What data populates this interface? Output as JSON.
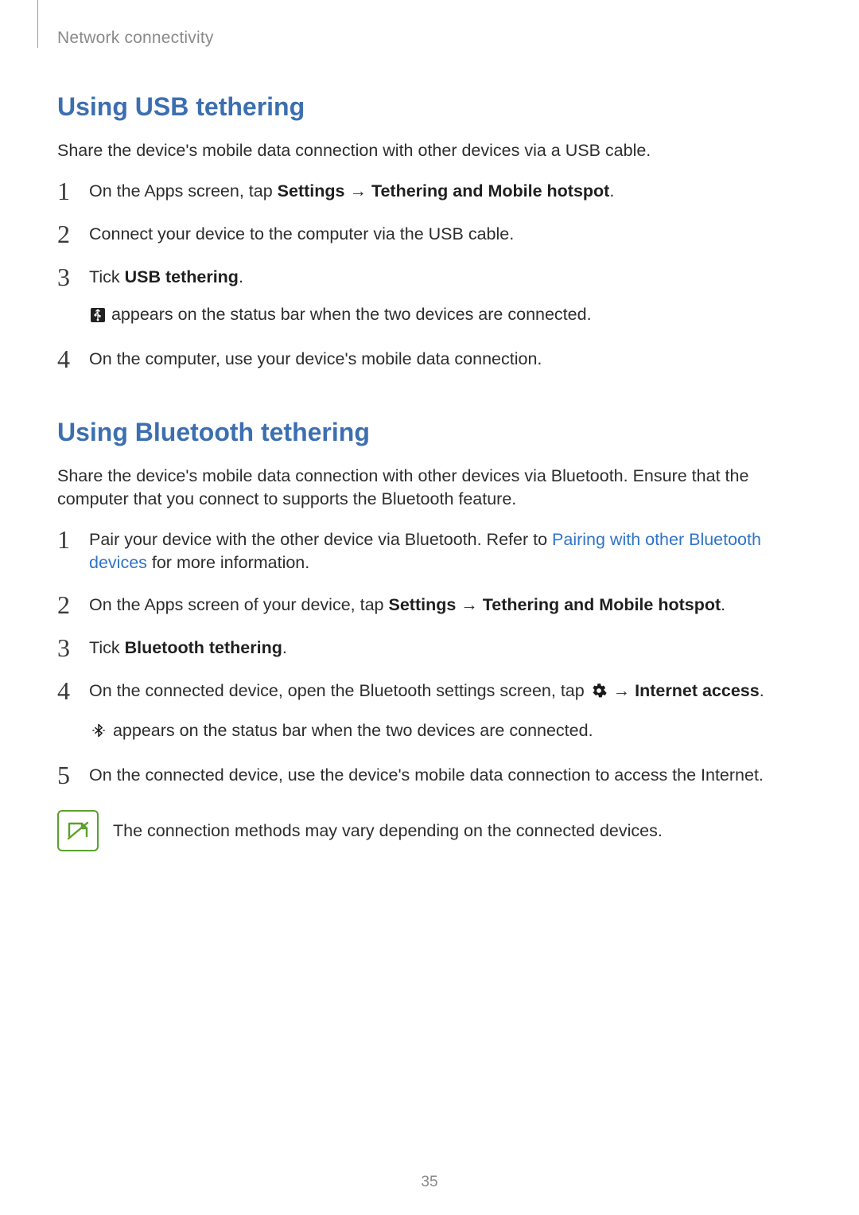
{
  "breadcrumb": "Network connectivity",
  "usb": {
    "heading": "Using USB tethering",
    "intro": "Share the device's mobile data connection with other devices via a USB cable.",
    "steps": {
      "s1_pre": "On the Apps screen, tap ",
      "s1_b1": "Settings",
      "s1_arrow": " → ",
      "s1_b2": "Tethering and Mobile hotspot",
      "s1_post": ".",
      "s2": "Connect your device to the computer via the USB cable.",
      "s3_pre": "Tick ",
      "s3_b": "USB tethering",
      "s3_post": ".",
      "s3_sub": " appears on the status bar when the two devices are connected.",
      "s4": "On the computer, use your device's mobile data connection."
    }
  },
  "bt": {
    "heading": "Using Bluetooth tethering",
    "intro": "Share the device's mobile data connection with other devices via Bluetooth. Ensure that the computer that you connect to supports the Bluetooth feature.",
    "steps": {
      "s1_pre": "Pair your device with the other device via Bluetooth. Refer to ",
      "s1_link": "Pairing with other Bluetooth devices",
      "s1_post": " for more information.",
      "s2_pre": "On the Apps screen of your device, tap ",
      "s2_b1": "Settings",
      "s2_arrow": " → ",
      "s2_b2": "Tethering and Mobile hotspot",
      "s2_post": ".",
      "s3_pre": "Tick ",
      "s3_b": "Bluetooth tethering",
      "s3_post": ".",
      "s4_pre": "On the connected device, open the Bluetooth settings screen, tap ",
      "s4_arrow": " → ",
      "s4_b": "Internet access",
      "s4_post": ".",
      "s4_sub": " appears on the status bar when the two devices are connected.",
      "s5": "On the connected device, use the device's mobile data connection to access the Internet."
    }
  },
  "note": "The connection methods may vary depending on the connected devices.",
  "nums": {
    "n1": "1",
    "n2": "2",
    "n3": "3",
    "n4": "4",
    "n5": "5"
  },
  "page_number": "35"
}
